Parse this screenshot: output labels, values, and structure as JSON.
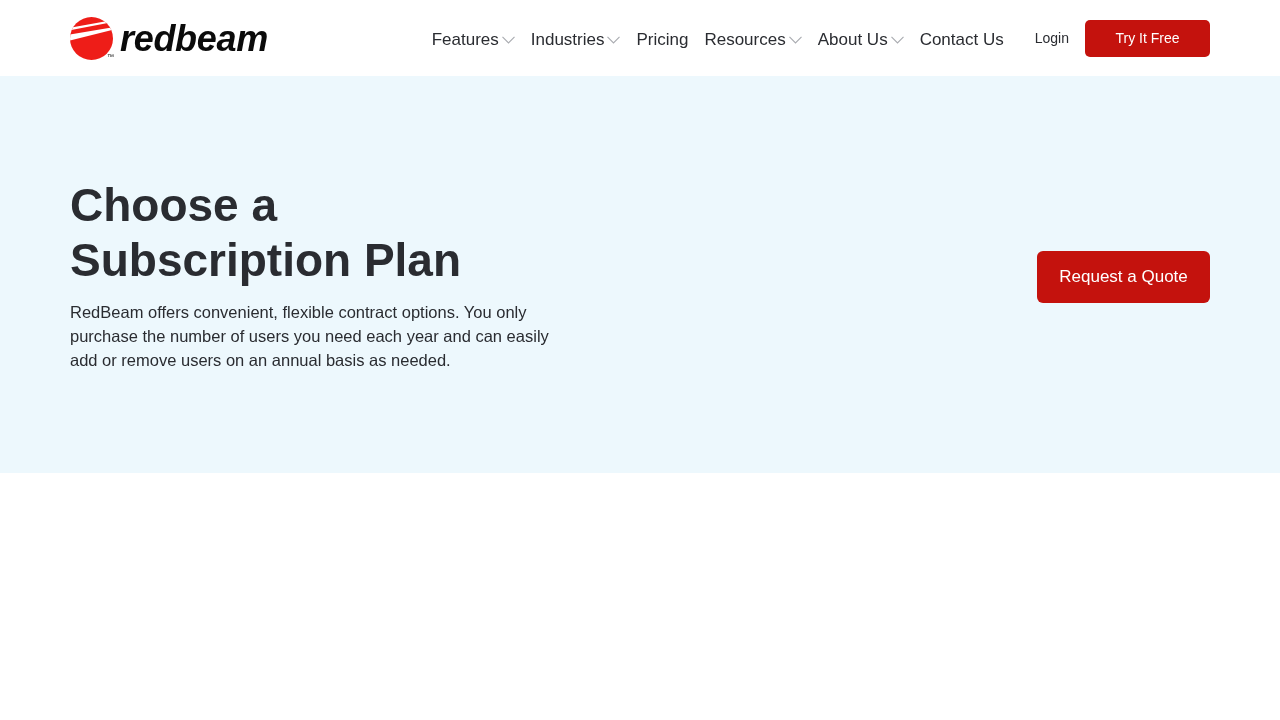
{
  "header": {
    "logo": {
      "wordmark": "redbeam",
      "trademark": "™"
    },
    "nav": [
      {
        "label": "Features",
        "dropdown": true
      },
      {
        "label": "Industries",
        "dropdown": true
      },
      {
        "label": "Pricing",
        "dropdown": false
      },
      {
        "label": "Resources",
        "dropdown": true
      },
      {
        "label": "About Us",
        "dropdown": true
      },
      {
        "label": "Contact Us",
        "dropdown": false
      }
    ],
    "login": "Login",
    "cta": "Try It Free"
  },
  "hero": {
    "title": "Choose a Subscription Plan",
    "description": "RedBeam offers convenient, flexible contract options. You only purchase the number of users you need each year and can easily add or remove users on an annual basis as needed.",
    "button": "Request a Quote"
  }
}
